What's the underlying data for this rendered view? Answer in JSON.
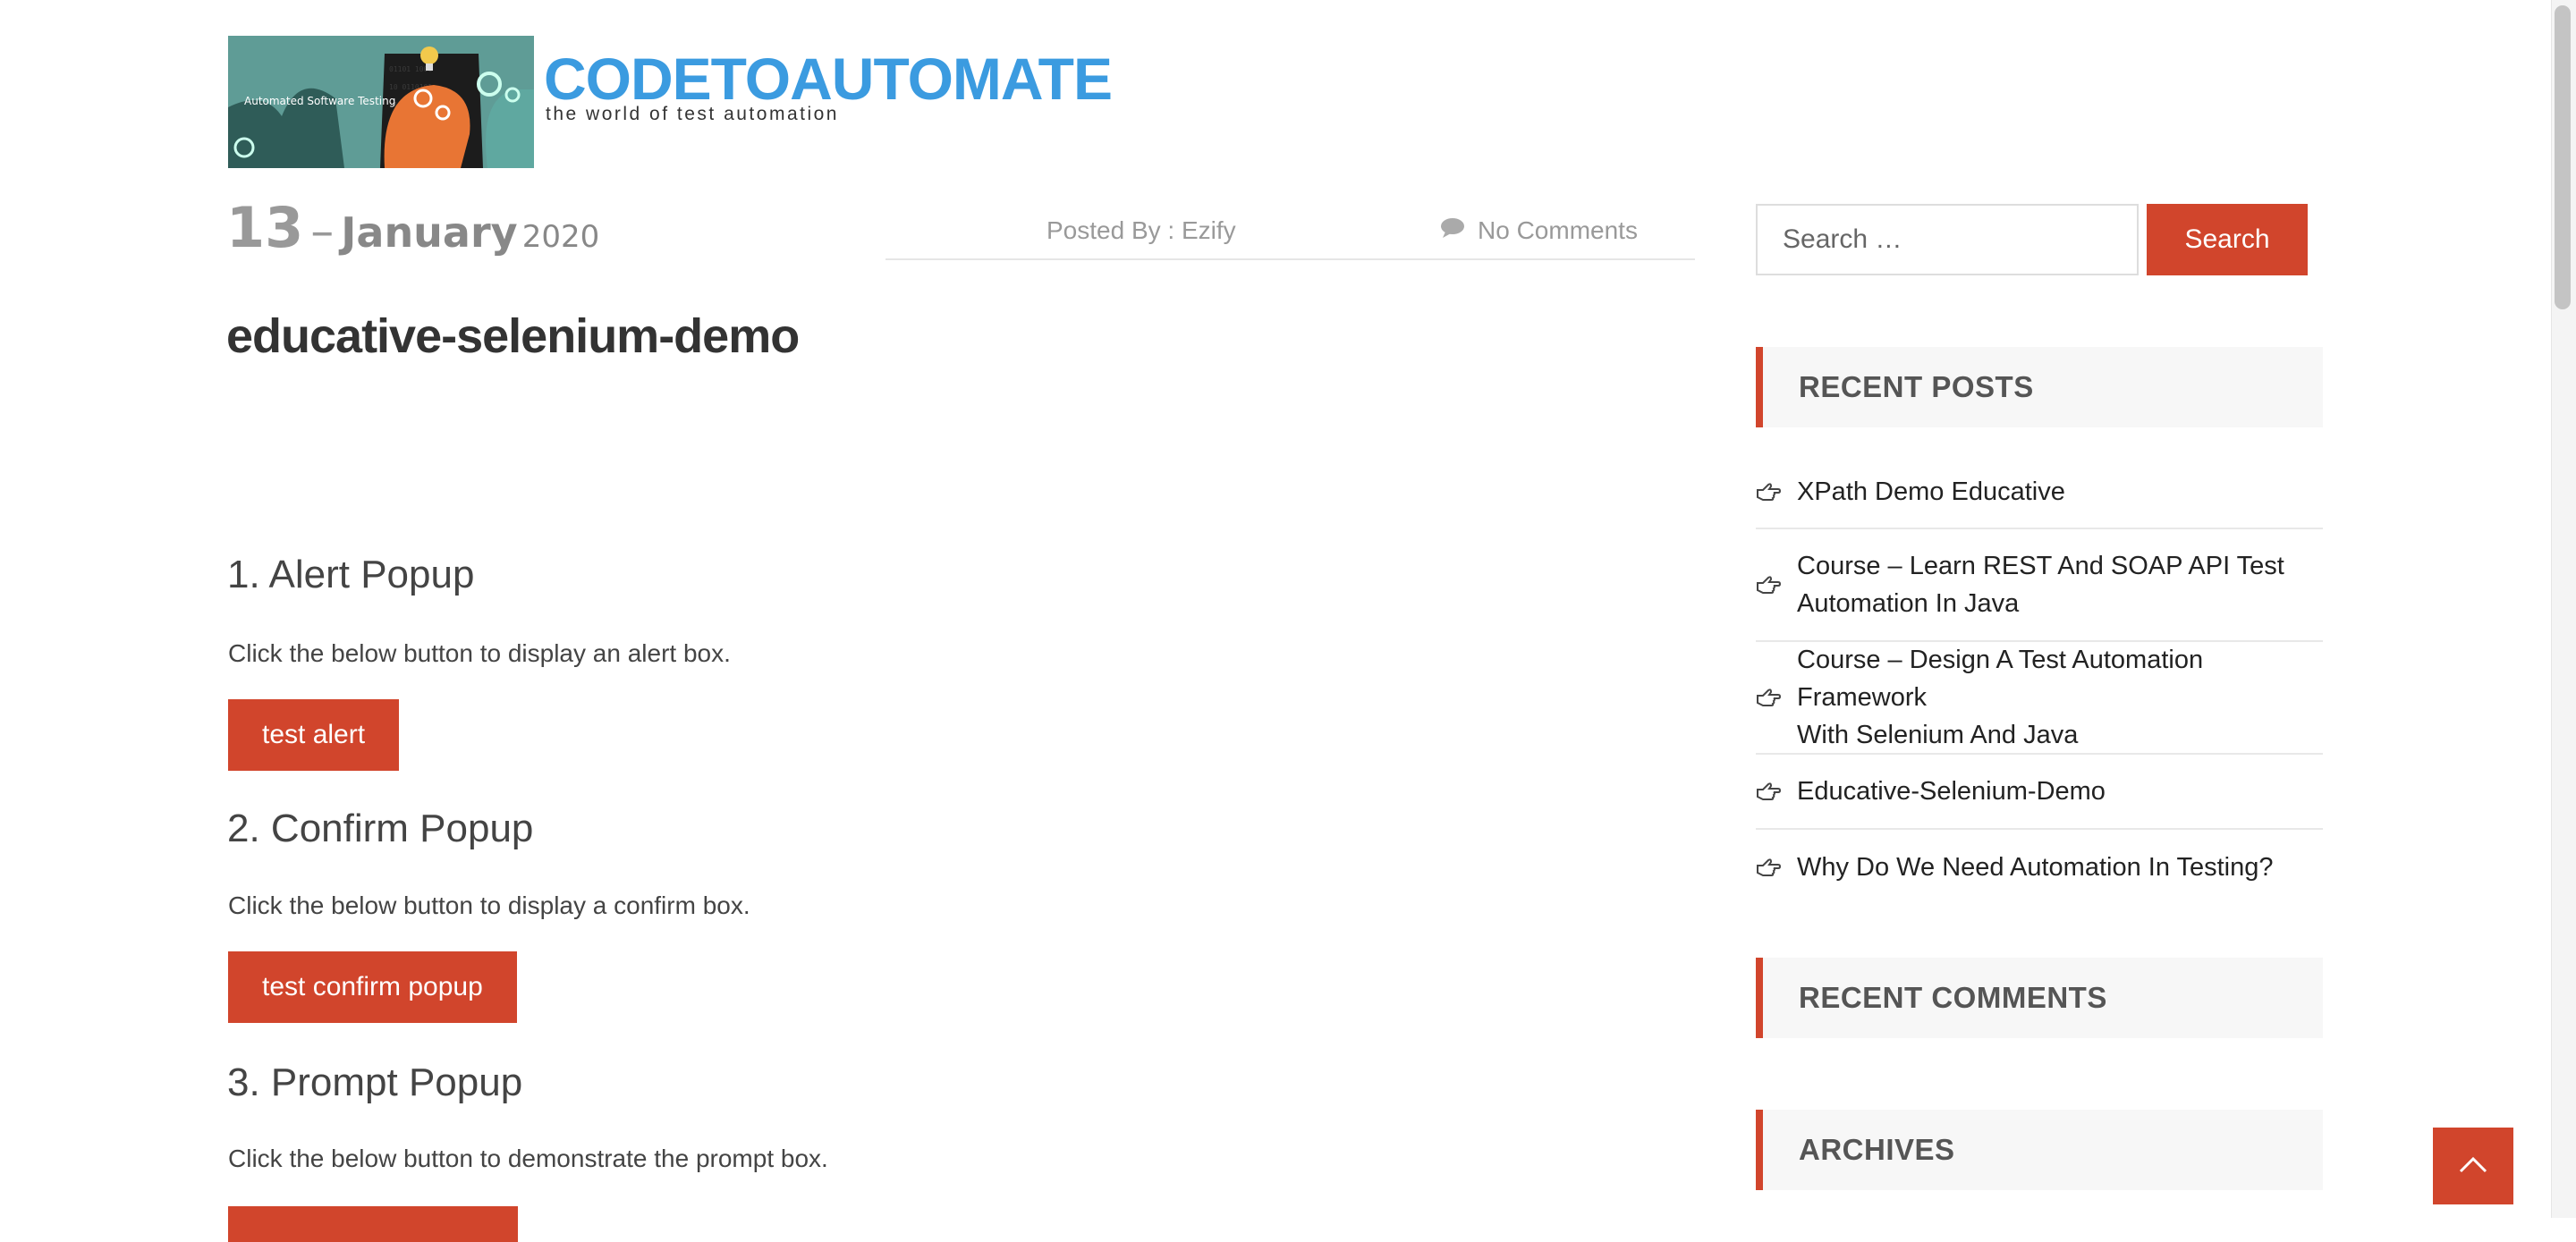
{
  "header": {
    "logo_text": "Automated Software Testing",
    "site_title": "CODETOAUTOMATE",
    "tagline": "the world of test automation"
  },
  "post": {
    "date": {
      "day": "13",
      "separator": "–",
      "month": "January",
      "year": "2020"
    },
    "posted_by": "Posted By : Ezify",
    "comments": "No Comments",
    "title": "educative-selenium-demo",
    "sections": [
      {
        "heading": "1. Alert Popup",
        "text": "Click the below button to display an alert box.",
        "button": "test alert"
      },
      {
        "heading": "2. Confirm Popup",
        "text": "Click the below button to display a confirm box.",
        "button": "test confirm popup"
      },
      {
        "heading": "3. Prompt Popup",
        "text": "Click the below button to demonstrate the prompt box.",
        "button": ""
      }
    ]
  },
  "sidebar": {
    "search": {
      "placeholder": "Search …",
      "button": "Search"
    },
    "recent_posts_title": "RECENT POSTS",
    "recent_posts": [
      {
        "line1": "XPath Demo Educative",
        "line2": ""
      },
      {
        "line1": "Course – Learn REST And SOAP API Test",
        "line2": "Automation In Java"
      },
      {
        "line1": "Course – Design A Test Automation Framework",
        "line2": "With Selenium And Java"
      },
      {
        "line1": "Educative-Selenium-Demo",
        "line2": ""
      },
      {
        "line1": "Why Do We Need Automation In Testing?",
        "line2": ""
      }
    ],
    "recent_comments_title": "RECENT COMMENTS",
    "archives_title": "ARCHIVES"
  },
  "colors": {
    "accent": "#d1452c",
    "brand": "#3b9be0"
  },
  "icons": [
    "hand-point-right-icon",
    "comment-icon",
    "chevron-up-icon"
  ]
}
